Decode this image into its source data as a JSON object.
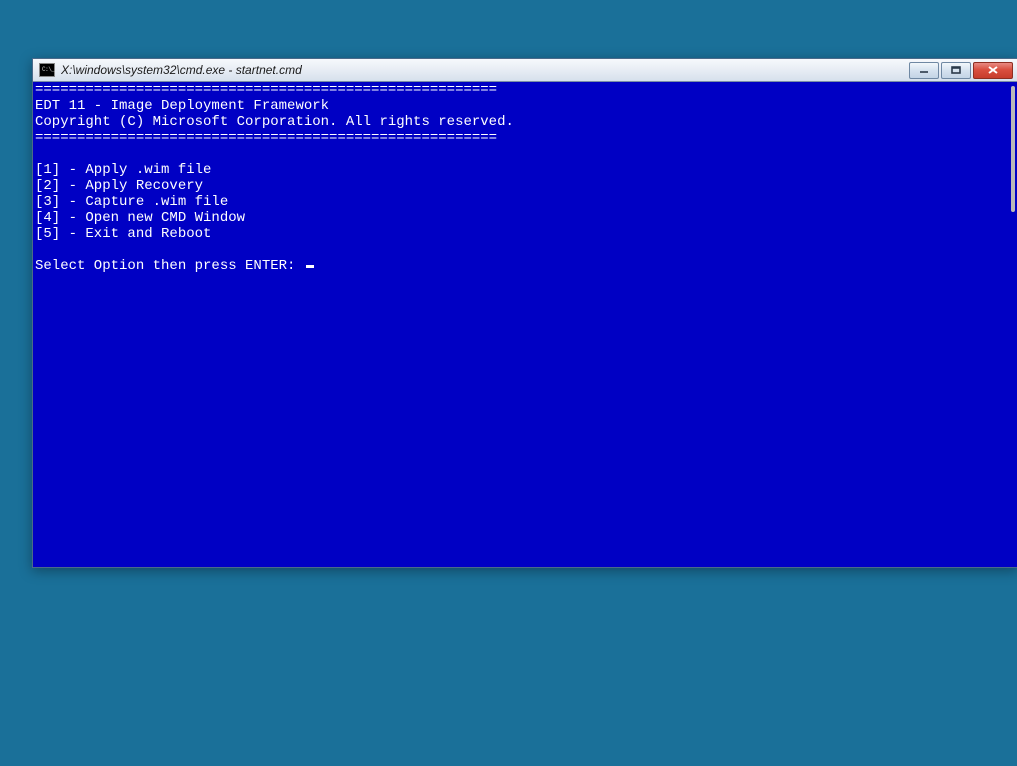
{
  "window": {
    "title": "X:\\windows\\system32\\cmd.exe - startnet.cmd"
  },
  "console": {
    "rule": "=======================================================",
    "title_line": "EDT 11 - Image Deployment Framework",
    "copyright_line": "Copyright (C) Microsoft Corporation. All rights reserved.",
    "options": [
      "[1] - Apply .wim file",
      "[2] - Apply Recovery",
      "[3] - Capture .wim file",
      "[4] - Open new CMD Window",
      "[5] - Exit and Reboot"
    ],
    "prompt": "Select Option then press ENTER: "
  }
}
